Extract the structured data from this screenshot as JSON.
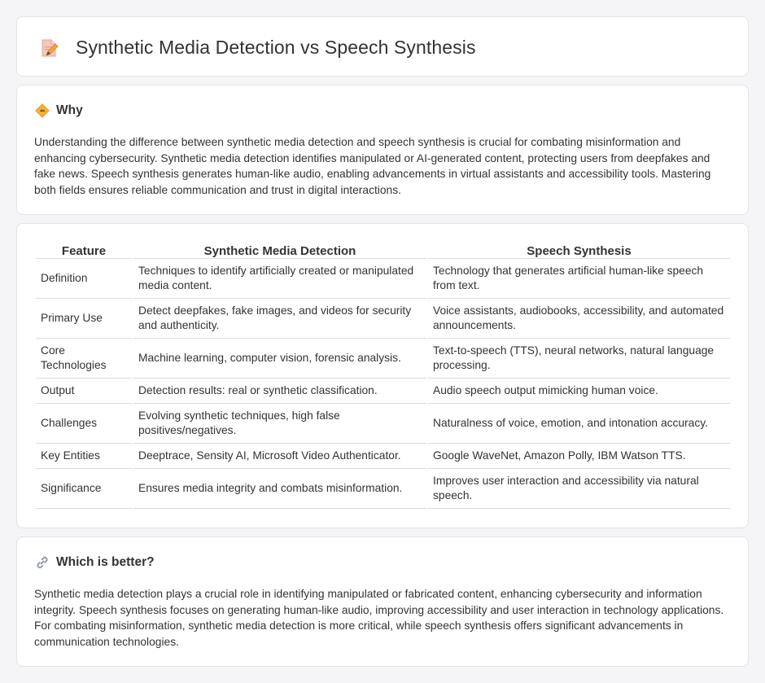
{
  "header": {
    "title": "Synthetic Media Detection vs Speech Synthesis",
    "icon": "document-pen-icon"
  },
  "why": {
    "title": "Why",
    "icon": "diamond-sign-icon",
    "text": "Understanding the difference between synthetic media detection and speech synthesis is crucial for combating misinformation and enhancing cybersecurity. Synthetic media detection identifies manipulated or AI-generated content, protecting users from deepfakes and fake news. Speech synthesis generates human-like audio, enabling advancements in virtual assistants and accessibility tools. Mastering both fields ensures reliable communication and trust in digital interactions."
  },
  "table": {
    "headers": [
      "Feature",
      "Synthetic Media Detection",
      "Speech Synthesis"
    ],
    "rows": [
      [
        "Definition",
        "Techniques to identify artificially created or manipulated media content.",
        "Technology that generates artificial human-like speech from text."
      ],
      [
        "Primary Use",
        "Detect deepfakes, fake images, and videos for security and authenticity.",
        "Voice assistants, audiobooks, accessibility, and automated announcements."
      ],
      [
        "Core Technologies",
        "Machine learning, computer vision, forensic analysis.",
        "Text-to-speech (TTS), neural networks, natural language processing."
      ],
      [
        "Output",
        "Detection results: real or synthetic classification.",
        "Audio speech output mimicking human voice."
      ],
      [
        "Challenges",
        "Evolving synthetic techniques, high false positives/negatives.",
        "Naturalness of voice, emotion, and intonation accuracy."
      ],
      [
        "Key Entities",
        "Deeptrace, Sensity AI, Microsoft Video Authenticator.",
        "Google WaveNet, Amazon Polly, IBM Watson TTS."
      ],
      [
        "Significance",
        "Ensures media integrity and combats misinformation.",
        "Improves user interaction and accessibility via natural speech."
      ]
    ]
  },
  "better": {
    "title": "Which is better?",
    "icon": "link-icon",
    "text": "Synthetic media detection plays a crucial role in identifying manipulated or fabricated content, enhancing cybersecurity and information integrity. Speech synthesis focuses on generating human-like audio, improving accessibility and user interaction in technology applications. For combating misinformation, synthetic media detection is more critical, while speech synthesis offers significant advancements in communication technologies."
  }
}
